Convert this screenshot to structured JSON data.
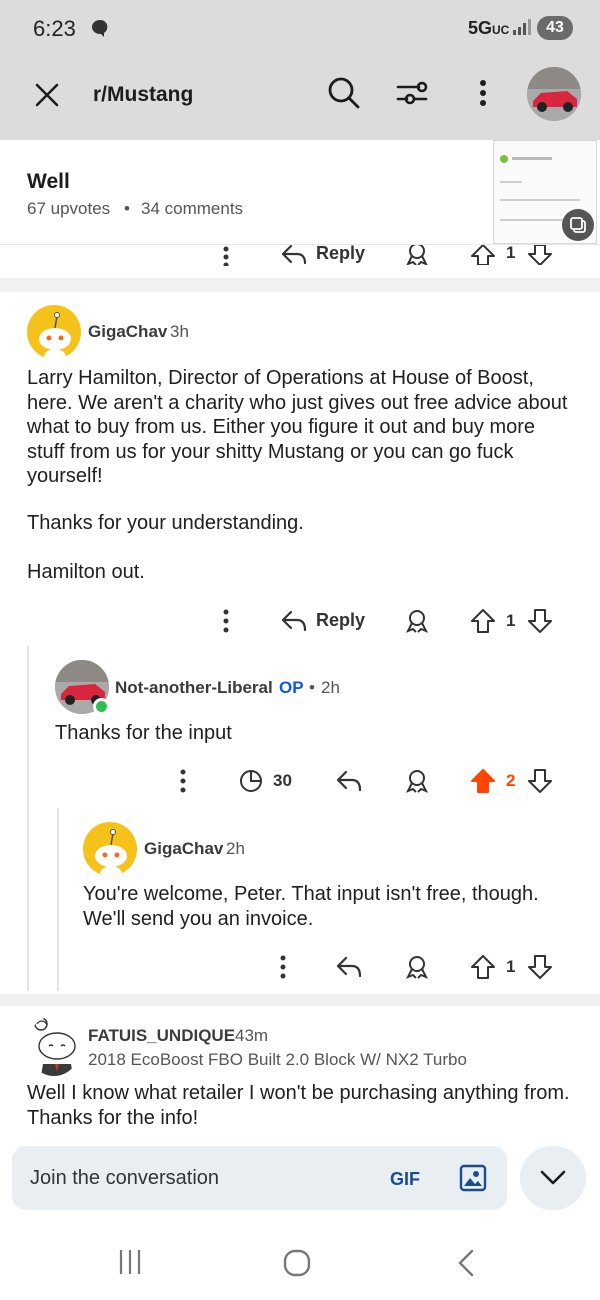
{
  "status_bar": {
    "time": "6:23",
    "network": "5G",
    "network_sub": "UC",
    "battery": "43"
  },
  "app_bar": {
    "subreddit": "r/Mustang"
  },
  "post_header": {
    "title": "Well",
    "upvotes": "67 upvotes",
    "separator": "•",
    "comments": "34 comments"
  },
  "prev_actions": {
    "reply_label": "Reply",
    "vote_count": "1"
  },
  "comments": [
    {
      "user": "GigaChav",
      "age": "3h",
      "body": "Larry Hamilton, Director of Operations at House of Boost, here. We aren't a charity who just gives out free advice about what to buy from us. Either you figure it out and buy more stuff from us for your shitty Mustang or you can go fuck yourself!",
      "body2": "Thanks for your understanding.",
      "body3": "Hamilton out.",
      "reply_label": "Reply",
      "vote_count": "1"
    },
    {
      "user": "Not-another-Liberal",
      "op_badge": "OP",
      "age_sep": "•",
      "age": "2h",
      "body": "Thanks for the input",
      "views": "30",
      "vote_count": "2"
    },
    {
      "user": "GigaChav",
      "age": "2h",
      "body": "You're welcome, Peter. That input isn't free, though. We'll send you an invoice.",
      "vote_count": "1"
    },
    {
      "user": "FATUIS_UNDIQUE",
      "age": "43m",
      "flair": "2018 EcoBoost FBO Built 2.0 Block W/ NX2 Turbo",
      "body": "Well I know what retailer I won't be purchasing anything from. Thanks for the info!"
    }
  ],
  "composer": {
    "placeholder": "Join the conversation",
    "gif_label": "GIF"
  },
  "colors": {
    "upvote_active": "#ff4500",
    "op_badge": "#0a5bd6",
    "online_dot": "#2fbf4f",
    "snoo_yellow": "#f4c21b"
  },
  "icons": [
    "close-icon",
    "search-icon",
    "filter-icon",
    "more-vertical-icon",
    "reply-icon",
    "award-icon",
    "upvote-icon",
    "downvote-icon",
    "views-icon",
    "image-icon",
    "chevron-down-icon"
  ]
}
